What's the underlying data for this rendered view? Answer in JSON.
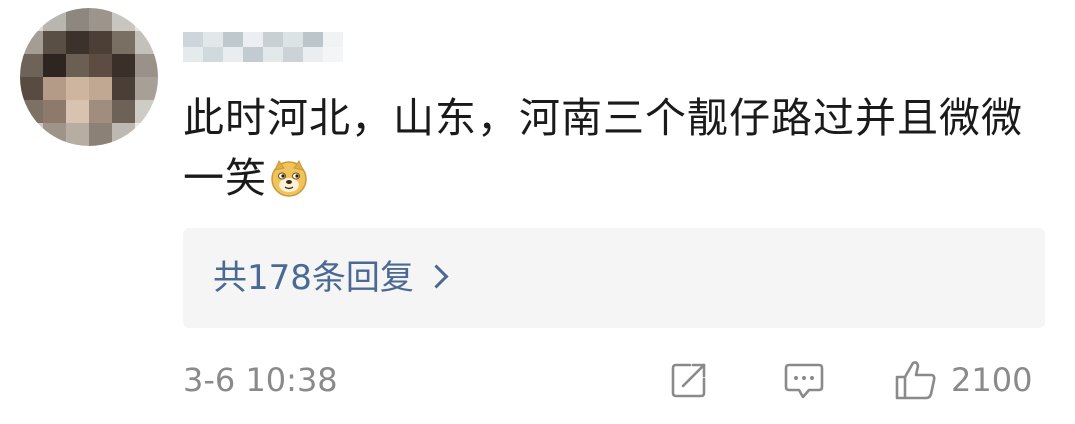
{
  "comment": {
    "text": "此时河北，山东，河南三个靓仔路过并且微微一笑",
    "emoji_icon": "doge-icon"
  },
  "replies": {
    "label": "共178条回复",
    "icon": "chevron-right-icon"
  },
  "meta": {
    "timestamp": "3-6 10:38"
  },
  "actions": {
    "share_icon": "share-icon",
    "comment_icon": "comment-icon",
    "like_icon": "thumbs-up-icon",
    "like_count": "2100"
  },
  "colors": {
    "text": "#1a1a1a",
    "link": "#4a6a95",
    "muted": "#8a8a8a",
    "panel": "#f5f5f5"
  }
}
